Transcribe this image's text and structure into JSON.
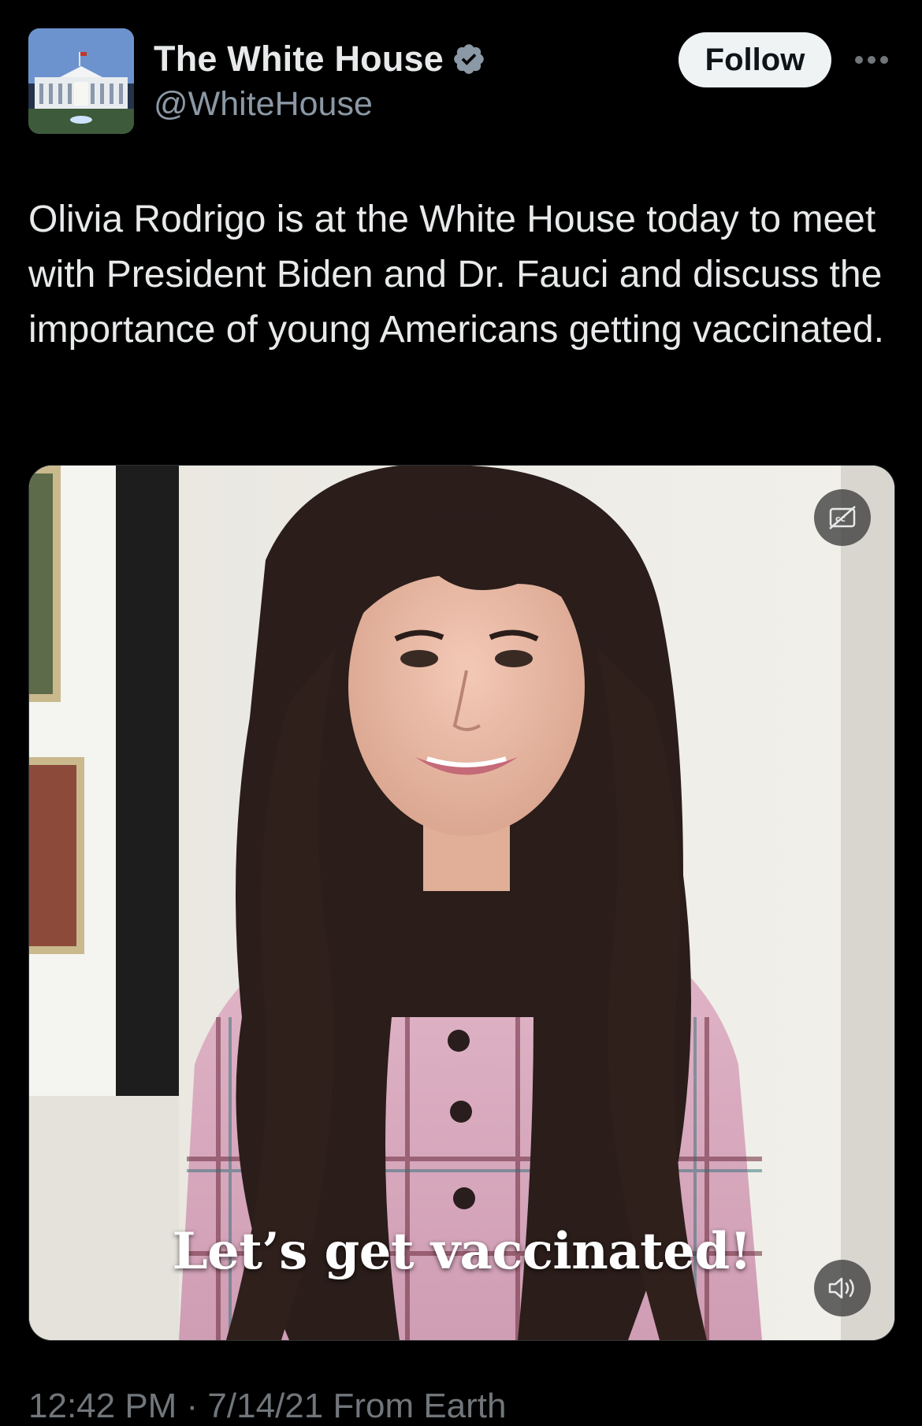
{
  "author": {
    "display_name": "The White House",
    "handle": "@WhiteHouse",
    "verified": true,
    "verified_color": "#8b98a5",
    "avatar_icon": "white-house-icon"
  },
  "actions": {
    "follow_label": "Follow",
    "more_icon": "more-dots-icon"
  },
  "tweet": {
    "text": "Olivia Rodrigo is at the White House today to meet with President Biden and Dr. Fauci and discuss the importance of young Americans getting vaccinated."
  },
  "media": {
    "caption": "Let’s get vaccinated!",
    "captions_icon": "captions-off-icon",
    "sound_icon": "volume-icon"
  },
  "footer": {
    "timestamp": "12:42 PM · 7/14/21 From Earth"
  }
}
